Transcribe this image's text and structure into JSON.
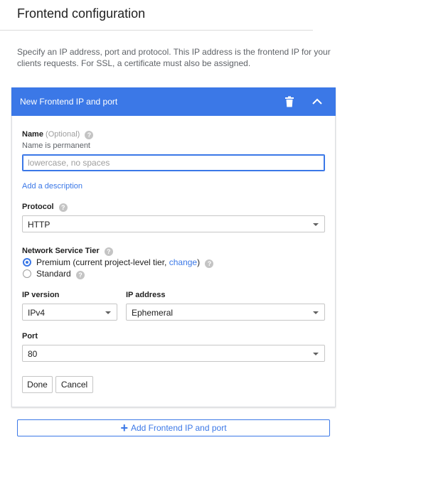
{
  "page": {
    "title": "Frontend configuration",
    "intro": "Specify an IP address, port and protocol. This IP address is the frontend IP for your clients requests. For SSL, a certificate must also be assigned."
  },
  "panel": {
    "title": "New Frontend IP and port",
    "icons": {
      "delete": "trash-icon",
      "collapse": "chevron-up-icon",
      "help": "help-icon"
    }
  },
  "name_field": {
    "label": "Name",
    "optional": "(Optional)",
    "hint": "Name is permanent",
    "value": "",
    "placeholder": "lowercase, no spaces"
  },
  "add_description": "Add a description",
  "protocol": {
    "label": "Protocol",
    "value": "HTTP"
  },
  "network_tier": {
    "label": "Network Service Tier",
    "premium_text": "Premium (current project-level tier, ",
    "premium_link": "change",
    "premium_suffix": ")",
    "standard": "Standard",
    "selected": "Premium"
  },
  "ip_version": {
    "label": "IP version",
    "value": "IPv4"
  },
  "ip_address": {
    "label": "IP address",
    "value": "Ephemeral"
  },
  "port": {
    "label": "Port",
    "value": "80"
  },
  "buttons": {
    "done": "Done",
    "cancel": "Cancel"
  },
  "add_frontend": "Add Frontend IP and port",
  "colors": {
    "accent": "#3b78e7",
    "border": "#c6c6c6",
    "muted": "#5f6368"
  }
}
